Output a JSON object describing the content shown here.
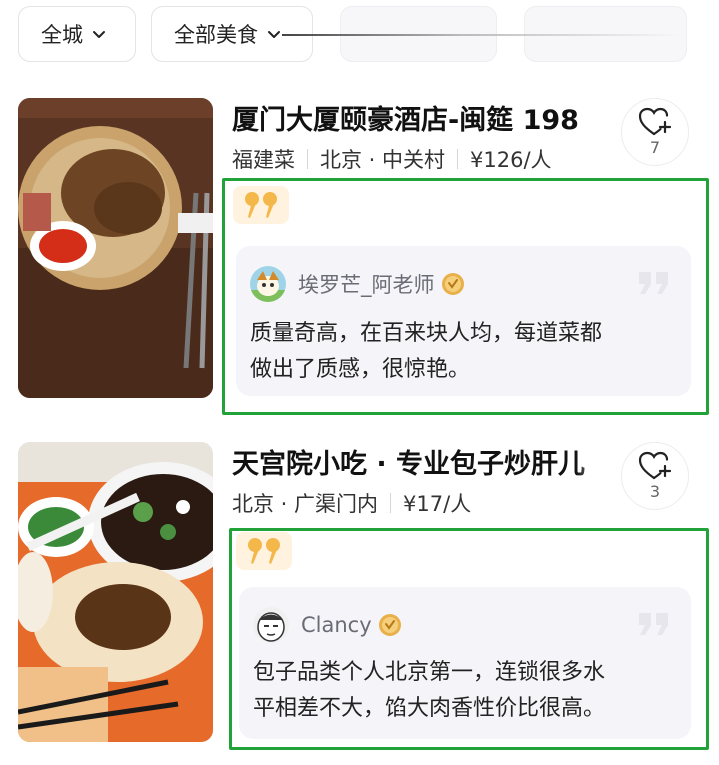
{
  "filters": {
    "city": "全城",
    "cuisine": "全部美食"
  },
  "restaurants": [
    {
      "title": "厦门大厦颐豪酒店-闽筵 198",
      "tags": [
        "福建菜",
        "北京 · 中关村",
        "¥126/人"
      ],
      "fav_count": "7",
      "review": {
        "user": "埃罗芒_阿老师",
        "lines": [
          "质量奇高，在百来块人均，每道菜都",
          "做出了质感，很惊艳。"
        ]
      }
    },
    {
      "title": "天宫院小吃 · 专业包子炒肝儿",
      "tags": [
        "北京 · 广渠门内",
        "¥17/人"
      ],
      "fav_count": "3",
      "review": {
        "user": "Clancy",
        "lines": [
          "包子品类个人北京第一，连锁很多水",
          "平相差不大，馅大肉香性价比很高。"
        ]
      }
    }
  ],
  "colors": {
    "highlight_border": "#21a33a",
    "quote_badge": "#f4b74a",
    "medal": "#e8b04a"
  }
}
